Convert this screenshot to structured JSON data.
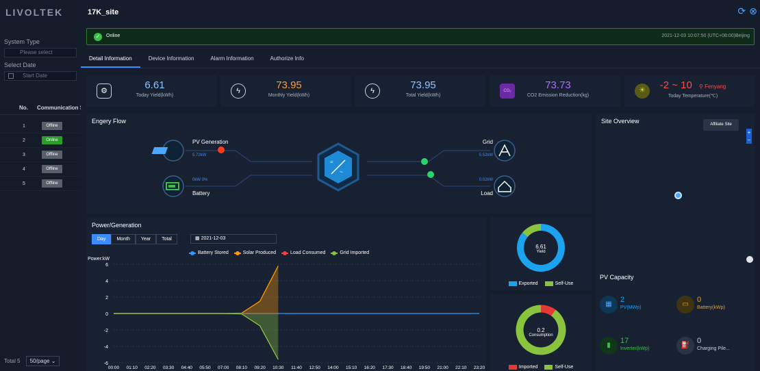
{
  "app": {
    "logo": "LIVOLTEK"
  },
  "sidebar": {
    "system_type_label": "System Type",
    "system_type_placeholder": "Please select",
    "select_date_label": "Select Date",
    "start_date_placeholder": "Start Date",
    "table_headers": [
      "No.",
      "Communication S"
    ],
    "rows": [
      {
        "no": "1",
        "status": "Offline"
      },
      {
        "no": "2",
        "status": "Online"
      },
      {
        "no": "3",
        "status": "Offline"
      },
      {
        "no": "4",
        "status": "Offline"
      },
      {
        "no": "5",
        "status": "Offline"
      }
    ],
    "total_label": "Total 5",
    "page_size": "50/page"
  },
  "panel": {
    "title": "17K_site",
    "status": "Online",
    "timestamp": "2021-12-03 10:07:50 (UTC+08:00)Beijing",
    "tabs": [
      "Detail Information",
      "Device Information",
      "Alarm Information",
      "Authorize Info"
    ],
    "active_tab": 0
  },
  "kpis": [
    {
      "value": "6.61",
      "label": "Today Yield(kWh)",
      "color": "#8fc4ff"
    },
    {
      "value": "73.95",
      "label": "Monthly Yield(kWh)",
      "color": "#ff9a3c"
    },
    {
      "value": "73.95",
      "label": "Total Yield(kWh)",
      "color": "#8fc4ff"
    },
    {
      "value": "73.73",
      "label": "CO2 Emission Reduction(kg)",
      "color": "#b36bff"
    },
    {
      "value": "-2 ~ 10",
      "label": "Today Temperature(℃)",
      "color": "#ff4b4b",
      "location": "Fenyang"
    }
  ],
  "energy_flow": {
    "title": "Engery Flow",
    "pv_label": "PV Generation",
    "pv_value": "5.72kW",
    "battery_label": "Battery",
    "battery_value": "0kW 0%",
    "grid_label": "Grid",
    "grid_value": "5.52kW",
    "load_label": "Load",
    "load_value": "0.02kW"
  },
  "power_gen": {
    "title": "Power/Generation",
    "ranges": [
      "Day",
      "Month",
      "Year",
      "Total"
    ],
    "active_range": 0,
    "date": "2021-12-03"
  },
  "chart_data": {
    "type": "area",
    "ylabel": "Power:kW",
    "ylim": [
      -6,
      6
    ],
    "yticks": [
      6,
      4,
      2,
      0,
      -2,
      -4,
      -6
    ],
    "x": [
      "00:00",
      "01:10",
      "02:20",
      "03:30",
      "04:40",
      "05:50",
      "07:00",
      "08:10",
      "09:20",
      "10:30",
      "11:40",
      "12:50",
      "14:00",
      "15:10",
      "16:20",
      "17:30",
      "18:40",
      "19:50",
      "21:00",
      "22:10",
      "23:20"
    ],
    "series": [
      {
        "name": "Battery Stored",
        "color": "#2b9bff",
        "values": [
          0,
          0,
          0,
          0,
          0,
          0,
          0,
          0,
          0,
          0,
          0,
          0,
          0,
          0,
          0,
          0,
          0,
          0,
          0,
          0,
          0
        ]
      },
      {
        "name": "Solar Produced",
        "color": "#ff9a00",
        "values": [
          0,
          0,
          0,
          0,
          0,
          0,
          0,
          0.05,
          1.5,
          5.8,
          null,
          null,
          null,
          null,
          null,
          null,
          null,
          null,
          null,
          null,
          null
        ]
      },
      {
        "name": "Load Consumed",
        "color": "#ff3b3b",
        "values": [
          0,
          0,
          0,
          0,
          0,
          0,
          0,
          0.02,
          0.02,
          0.02,
          null,
          null,
          null,
          null,
          null,
          null,
          null,
          null,
          null,
          null,
          null
        ]
      },
      {
        "name": "Grid Imported",
        "color": "#8ac43f",
        "values": [
          0,
          0,
          0,
          0,
          0,
          0,
          0,
          -0.05,
          -1.5,
          -5.6,
          null,
          null,
          null,
          null,
          null,
          null,
          null,
          null,
          null,
          null,
          null
        ]
      }
    ],
    "grid": true,
    "legend_position": "top"
  },
  "donut_yield": {
    "value": "6.61",
    "label": "Yield",
    "legend": [
      "Exported",
      "Self-Use"
    ],
    "colors": [
      "#1ba3f0",
      "#8ac43f"
    ],
    "fractions": [
      0.86,
      0.14
    ]
  },
  "donut_consumption": {
    "value": "0.2",
    "label": "Consumption",
    "legend": [
      "Imported",
      "Self-Use"
    ],
    "colors": [
      "#e53935",
      "#8ac43f"
    ],
    "fractions": [
      0.1,
      0.9
    ]
  },
  "site_overview": {
    "title": "Site Overview",
    "button": "Affiliate Site",
    "zoom_in": "+",
    "zoom_out": "−"
  },
  "pv_capacity": {
    "title": "PV Capacity",
    "items": [
      {
        "value": "2",
        "label": "PV(MWp)",
        "color": "#1ba3f0",
        "icon": "solar-panel-icon"
      },
      {
        "value": "0",
        "label": "Battery(kWp)",
        "color": "#f0a020",
        "icon": "battery-icon"
      },
      {
        "value": "17",
        "label": "Inverter(kWp)",
        "color": "#3cbf4a",
        "icon": "inverter-icon"
      },
      {
        "value": "0",
        "label": "Charging Pile...",
        "color": "#c9d2e0",
        "icon": "charging-pile-icon"
      }
    ]
  }
}
